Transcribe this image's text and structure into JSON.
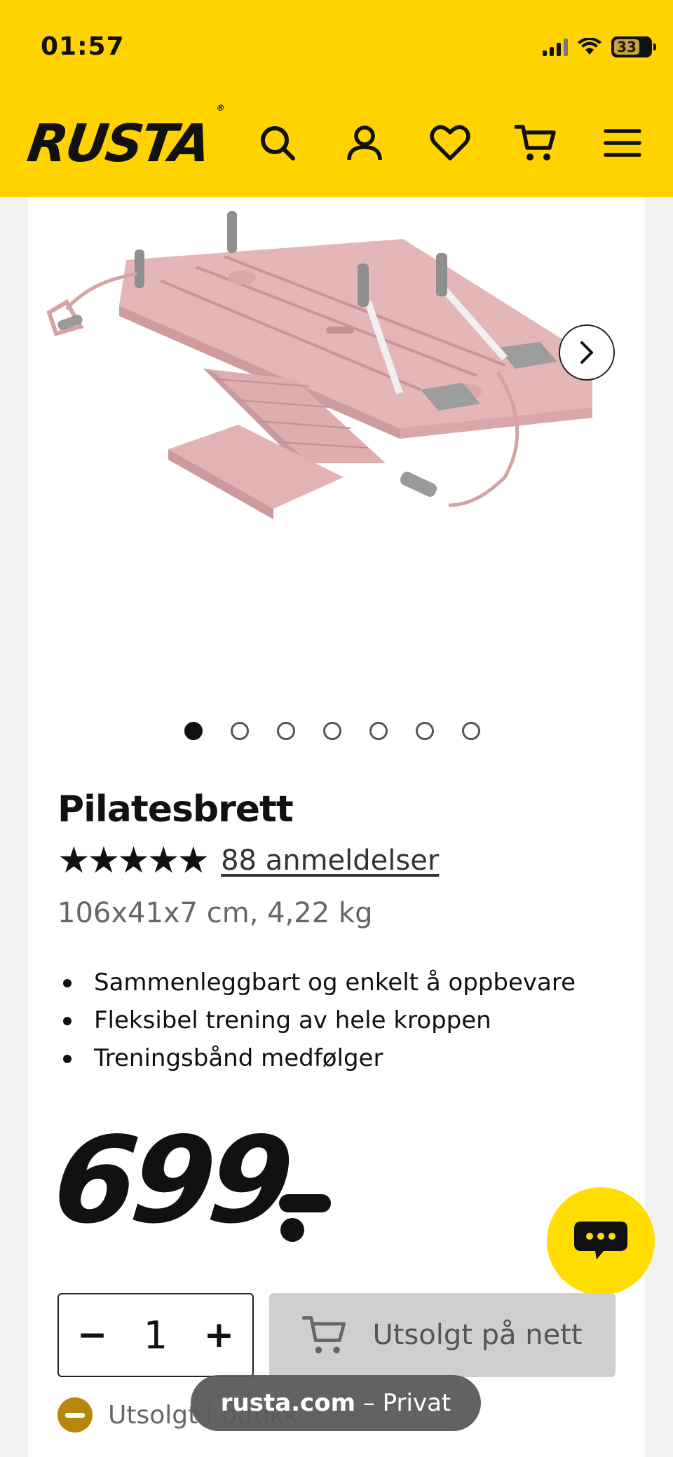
{
  "status_bar": {
    "time": "01:57",
    "battery": "33"
  },
  "header": {
    "logo": "RUSTA",
    "logo_mark": "®",
    "icons": [
      "search-icon",
      "account-icon",
      "heart-icon",
      "cart-icon",
      "menu-icon"
    ],
    "background_color": "#ffd200"
  },
  "gallery": {
    "image_count": 7,
    "active_index": 0
  },
  "product": {
    "title": "Pilatesbrett",
    "rating_stars": "★★★★★",
    "rating": 5,
    "reviews_label": "88 anmeldelser",
    "dimensions": "106x41x7 cm, 4,22 kg",
    "bullets": [
      "Sammenleggbart og enkelt å oppbevare",
      "Fleksibel trening av hele kroppen",
      "Treningsbånd medfølger"
    ],
    "price": "699"
  },
  "purchase": {
    "minus": "−",
    "quantity": "1",
    "plus": "+",
    "soldout_label": "Utsolgt på nett"
  },
  "store_status": {
    "label": "Utsolgt i butikk"
  },
  "browser": {
    "domain": "rusta.com",
    "mode": "– Privat"
  },
  "colors": {
    "brand_yellow": "#ffd200",
    "chat_yellow": "#ffdd00",
    "status_amber": "#b8860b"
  }
}
